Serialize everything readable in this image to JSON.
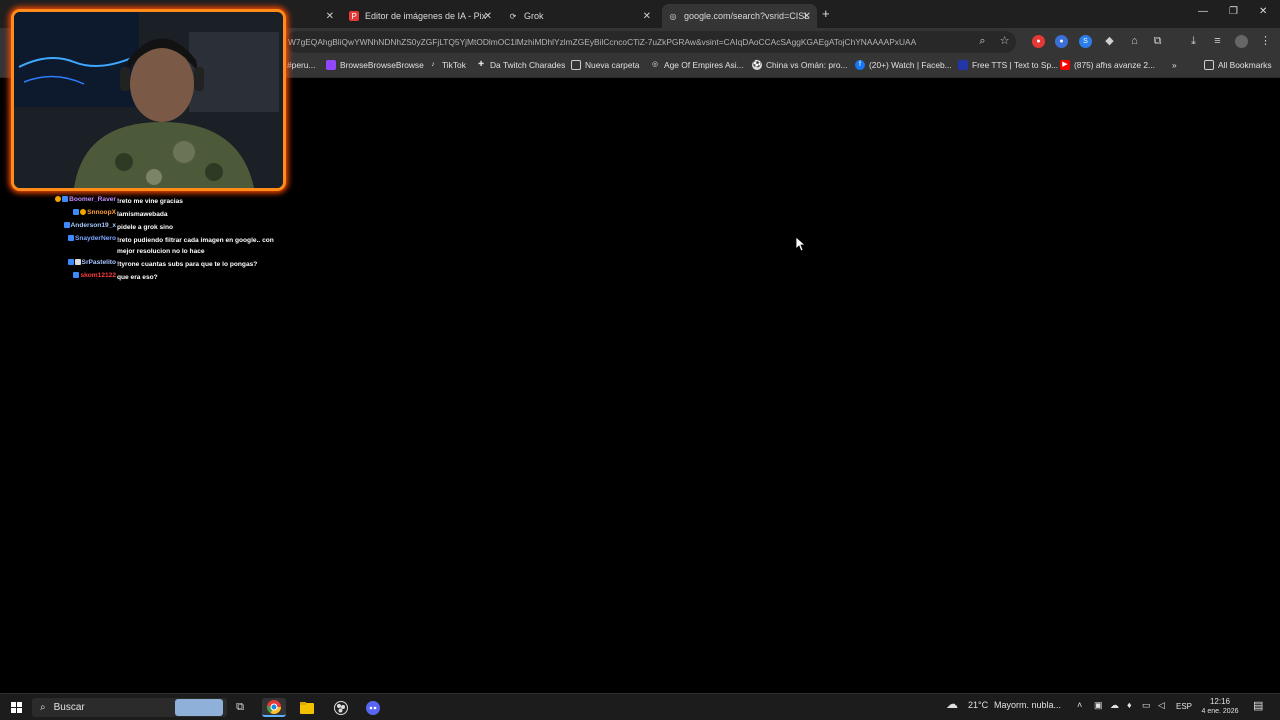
{
  "browser": {
    "tabs": [
      {
        "label": "",
        "active": false
      },
      {
        "label": "Editor de imágenes de IA - Pix",
        "active": false
      },
      {
        "label": "Grok",
        "active": false
      },
      {
        "label": "google.com/search?vsrid=CISL",
        "active": true
      }
    ],
    "new_tab": "+",
    "url": "W7gEQAhgBliQwYWNhNDNhZS0yZGFjLTQ5YjMtODlmOC1lMzhiMDhlYzlmZGEyBilCcncoCTiZ-7uZkPGRAw&vsint=CAIqDAoCCAcSAggKGAEgATojChYNAAAAPxUAA",
    "bookmarks": [
      "#peru...",
      "BrowseBrowseBrowse",
      "TikTok",
      "Da Twitch Charades",
      "Nueva carpeta",
      "Age Of Empires Asi...",
      "China vs Omán: pro...",
      "(20+) Watch | Faceb...",
      "Free TTS | Text to Sp...",
      "(875) afhs avanze 2...",
      "All Bookmarks"
    ],
    "more_bookmarks": "»"
  },
  "chat": {
    "messages": [
      {
        "user": "Boomer_Raver",
        "text": "!reto me vine gracias",
        "color": "#c58cff"
      },
      {
        "user": "SnnoopX",
        "text": "lamismawebada",
        "color": "#ff9a3c"
      },
      {
        "user": "Anderson19_x",
        "text": "pidele a grok sino",
        "color": "#a8c8ff"
      },
      {
        "user": "SnayderNero",
        "text": "!reto pudiendo filtrar cada imagen en google.. con mejor resolucion no lo hace",
        "color": "#7fa7ff"
      },
      {
        "user": "SrPastelito",
        "text": "!tyrone cuantas subs para que te lo pongas?",
        "color": "#a8c8ff"
      },
      {
        "user": "skom12122",
        "text": "que era eso?",
        "color": "#ff3b3b"
      }
    ]
  },
  "taskbar": {
    "search_placeholder": "Buscar",
    "weather_temp": "21°C",
    "weather_text": "Mayorm. nubla...",
    "language": "ESP",
    "time": "12:16",
    "date": "4 ene. 2026"
  },
  "colors": {
    "webcam_border": "#ff8c1a",
    "chrome_bg": "#1f1f1f",
    "toolbar_bg": "#353535"
  }
}
